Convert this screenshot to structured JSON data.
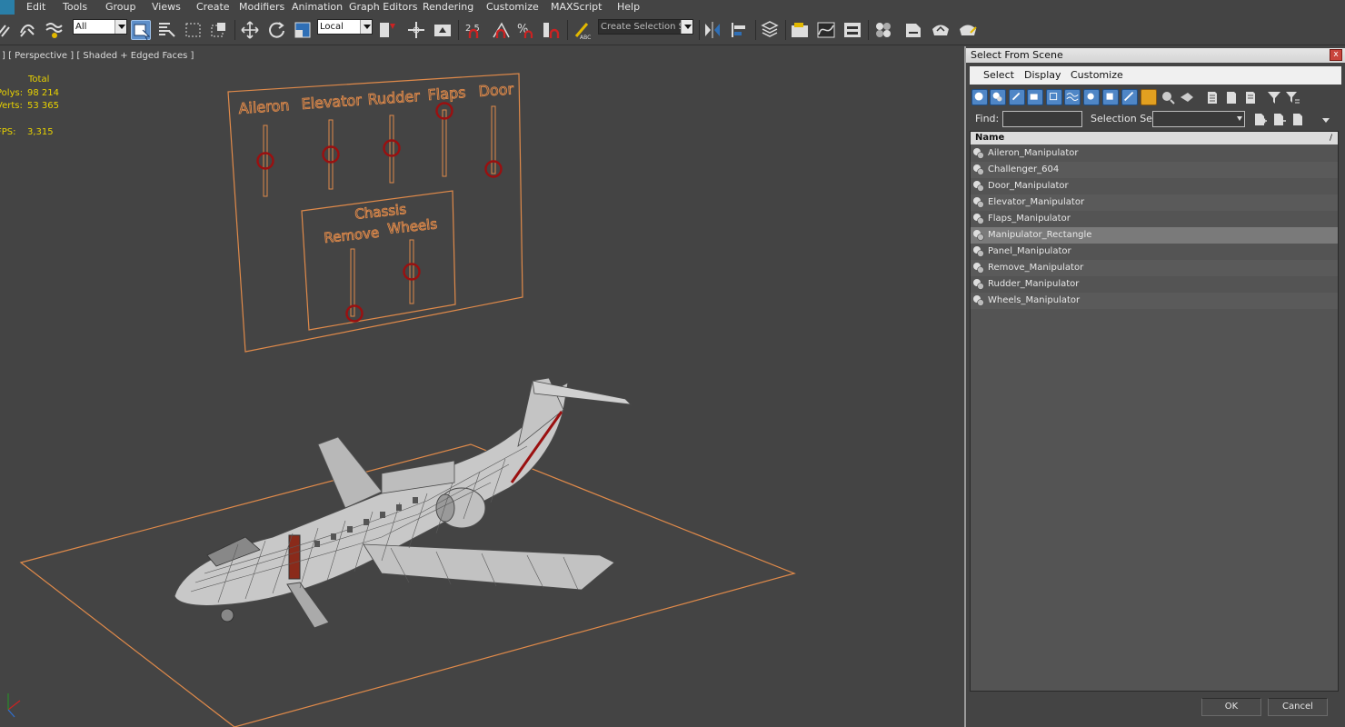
{
  "menu": {
    "items": [
      "Edit",
      "Tools",
      "Group",
      "Views",
      "Create",
      "Modifiers",
      "Animation",
      "Graph Editors",
      "Rendering",
      "Customize",
      "MAXScript",
      "Help"
    ]
  },
  "toolbar": {
    "selection_filter": "All",
    "coordinate_system": "Local",
    "spinner_snap": "2.5",
    "named_selection_placeholder": "Create Selection Se"
  },
  "viewport": {
    "label": "] [ Perspective ] [ Shaded + Edged Faces ]",
    "stats": {
      "total_label": "Total",
      "polys_label": "Polys:",
      "polys_value": "98 214",
      "verts_label": "Verts:",
      "verts_value": "53 365",
      "fps_label": "FPS:",
      "fps_value": "3,315"
    },
    "panel_labels": {
      "aileron": "Aileron",
      "elevator": "Elevator",
      "rudder": "Rudder",
      "flaps": "Flaps",
      "door": "Door",
      "chassis": "Chassis",
      "remove": "Remove",
      "wheels": "Wheels"
    },
    "colors": {
      "wire_orange": "#e08a4a",
      "manipulator_red": "#9a1010",
      "stats_yellow": "#e8d200"
    }
  },
  "dialog": {
    "title": "Select From Scene",
    "close_label": "x",
    "menu": [
      "Select",
      "Display",
      "Customize"
    ],
    "find_label": "Find:",
    "find_value": "",
    "selection_set_label": "Selection Set:",
    "selection_set_value": "",
    "list_header": "Name",
    "sort_indicator": "/",
    "items": [
      {
        "name": "Aileron_Manipulator",
        "selected": false
      },
      {
        "name": "Challenger_604",
        "selected": false
      },
      {
        "name": "Door_Manipulator",
        "selected": false
      },
      {
        "name": "Elevator_Manipulator",
        "selected": false
      },
      {
        "name": "Flaps_Manipulator",
        "selected": false
      },
      {
        "name": "Manipulator_Rectangle",
        "selected": true
      },
      {
        "name": "Panel_Manipulator",
        "selected": false
      },
      {
        "name": "Remove_Manipulator",
        "selected": false
      },
      {
        "name": "Rudder_Manipulator",
        "selected": false
      },
      {
        "name": "Wheels_Manipulator",
        "selected": false
      }
    ],
    "ok_label": "OK",
    "cancel_label": "Cancel"
  }
}
